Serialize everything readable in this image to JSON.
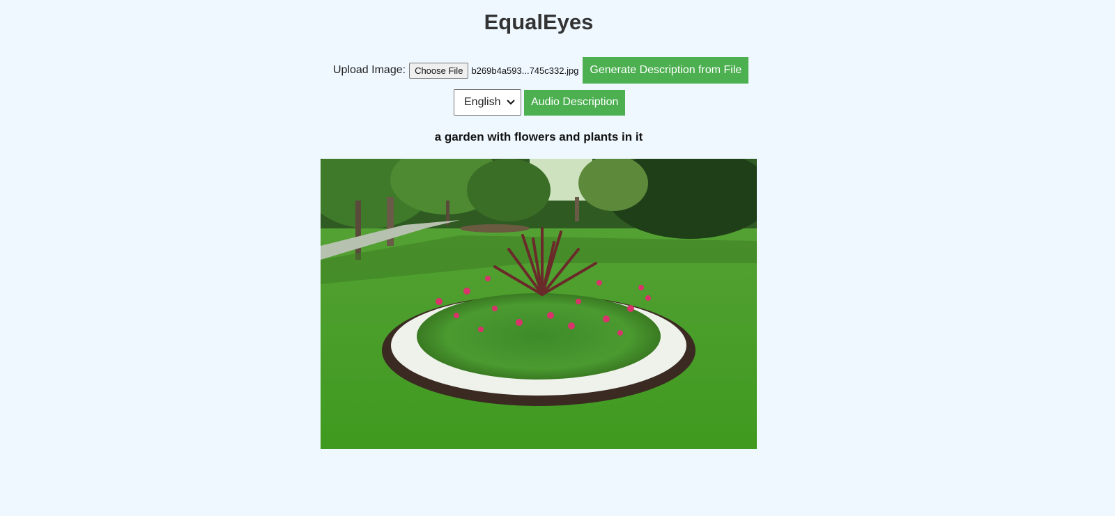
{
  "app": {
    "title": "EqualEyes"
  },
  "upload": {
    "label": "Upload Image:",
    "choose_file_label": "Choose File",
    "file_name": "b269b4a593...745c332.jpg",
    "generate_button_label": "Generate Description from File"
  },
  "language": {
    "selected": "English",
    "options": [
      "English"
    ],
    "audio_button_label": "Audio Description"
  },
  "result": {
    "caption": "a garden with flowers and plants in it"
  },
  "colors": {
    "background": "#eff8ff",
    "accent_button": "#4caf50"
  },
  "icons": {
    "select_arrow": "chevron-down-icon"
  }
}
